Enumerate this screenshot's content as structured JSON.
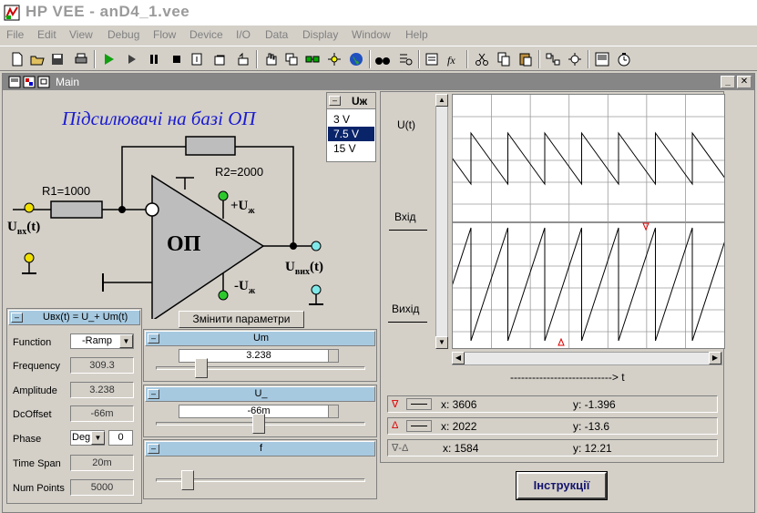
{
  "app": {
    "title": "HP VEE - anD4_1.vee"
  },
  "menu": [
    "File",
    "Edit",
    "View",
    "Debug",
    "Flow",
    "Device",
    "I/O",
    "Data",
    "Display",
    "Window",
    "Help"
  ],
  "main_window": {
    "title": "Main"
  },
  "schematic": {
    "title": "Підсилювачі на базі ОП",
    "r1": "R1=1000",
    "r2": "R2=2000",
    "opamp": "ОП",
    "uin_main": "U",
    "uin_sub": "вх",
    "uin_tail": "(t)",
    "uout_main": "U",
    "uout_sub": "вих",
    "uout_tail": "(t)",
    "plus_u": "+U",
    "plus_sub": "ж",
    "minus_u": "-U",
    "minus_sub": "ж"
  },
  "voltage_selector": {
    "title": "Uж",
    "options": [
      "3 V",
      "7.5 V",
      "15 V"
    ],
    "selected": "7.5 V"
  },
  "function_panel": {
    "title": "Uвх(t) = U_+ Um(t)",
    "function_label": "Function",
    "function_value": "-Ramp",
    "frequency_label": "Frequency",
    "frequency_value": "309.3",
    "amplitude_label": "Amplitude",
    "amplitude_value": "3.238",
    "dcoffset_label": "DcOffset",
    "dcoffset_value": "-66m",
    "phase_label": "Phase",
    "phase_unit": "Deg",
    "phase_value": "0",
    "timespan_label": "Time Span",
    "timespan_value": "20m",
    "numpoints_label": "Num Points",
    "numpoints_value": "5000"
  },
  "change_button": "Змінити параметри",
  "sliders": [
    {
      "name": "Um",
      "value": "3.238",
      "position": 0.2
    },
    {
      "name": "U_",
      "value": "-66m",
      "position": 0.49
    },
    {
      "name": "f",
      "value": "",
      "position": 0.13
    }
  ],
  "display": {
    "label_u": "U(t)",
    "label_in": "Вхід",
    "label_out": "Вихід",
    "t_axis": "----------------------------> t"
  },
  "markers": [
    {
      "symbol": "∇",
      "x": "x: 3606",
      "y": "y: -1.396"
    },
    {
      "symbol": "Δ",
      "x": "x: 2022",
      "y": "y: -13.6"
    },
    {
      "symbol": "∇-Δ",
      "x": "x: 1584",
      "y": "y: 12.21"
    }
  ],
  "instructions_button": "Інструкції",
  "colors": {
    "plot_line": "#000000",
    "slider_head": "#a6c9e0",
    "marker": "#e00000",
    "title_blue": "#1a1ad0"
  }
}
